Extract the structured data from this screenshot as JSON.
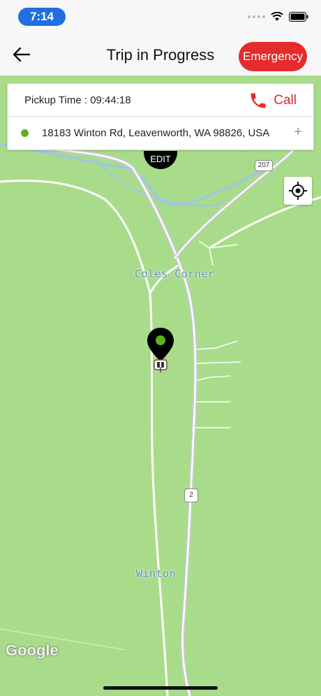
{
  "status_bar": {
    "time": "7:14"
  },
  "header": {
    "title": "Trip in Progress",
    "back_icon": "arrow-left-icon",
    "emergency_label": "Emergency",
    "colors": {
      "emergency": "#e52b2b"
    }
  },
  "trip_card": {
    "pickup_time": "Pickup Time : 09:44:18",
    "call_label": "Call",
    "call_icon": "phone-icon",
    "address": "18183 Winton Rd, Leavenworth, WA 98826, USA",
    "add_stop": "+",
    "edit_label": "EDIT",
    "colors": {
      "call": "#e52b2b",
      "pickup_dot": "#5fb21e"
    }
  },
  "map": {
    "places": {
      "coles_corner": "Coles Corner",
      "winton": "Winton"
    },
    "routes": {
      "us2": "2",
      "sr207": "207"
    },
    "attribution": "Google",
    "locate_icon": "crosshair-icon",
    "marker_icon": "map-pin-icon",
    "vehicle_icon": "car-icon",
    "colors": {
      "land": "#a8dc8a",
      "water": "#8ab4f8",
      "road": "#ffffff"
    }
  }
}
